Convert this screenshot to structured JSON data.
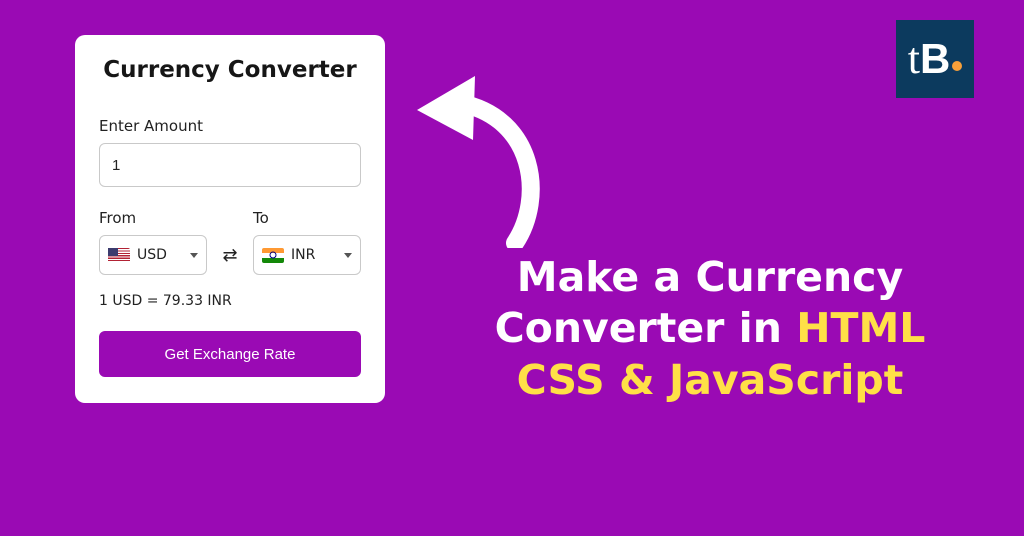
{
  "card": {
    "title": "Currency Converter",
    "amount_label": "Enter Amount",
    "amount_value": "1",
    "from_label": "From",
    "to_label": "To",
    "from_currency": "USD",
    "to_currency": "INR",
    "rate_text": "1 USD = 79.33 INR",
    "button_label": "Get Exchange Rate",
    "swap_symbol": "⇄"
  },
  "headline": {
    "line1": "Make a Currency",
    "line2a": "Converter in ",
    "line2b": "HTML",
    "line3": "CSS & JavaScript"
  },
  "logo": {
    "t": "t",
    "b": "B"
  },
  "colors": {
    "bg": "#9a0ab4",
    "accent": "#ffe047",
    "logo_bg": "#0c3a5e",
    "logo_dot": "#f8a03a"
  }
}
